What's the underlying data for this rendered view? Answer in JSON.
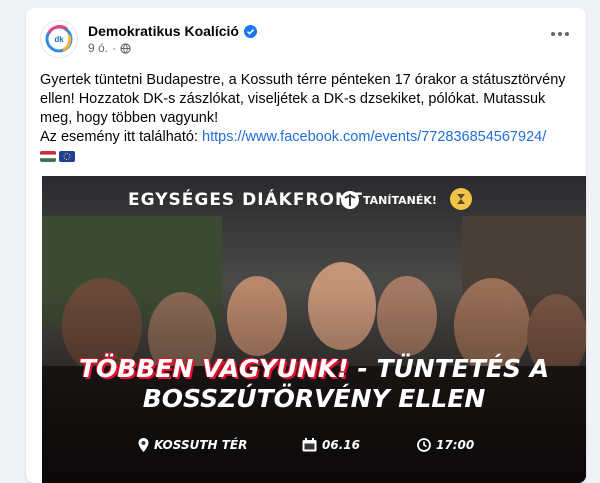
{
  "post": {
    "page_name": "Demokratikus Koalíció",
    "timestamp": "9 ó.",
    "separator": "·",
    "audience_icon": "globe-icon",
    "verified_icon": "verified-badge-icon",
    "more_icon": "more-options-icon",
    "text_line": "Gyertek tüntetni Budapestre, a Kossuth térre pénteken 17 órakor a státusztörvény ellen! Hozzatok DK-s zászlókat, viseljétek a DK-s dzsekiket, pólókat. Mutassuk meg, hogy többen vagyunk!",
    "link_prefix": "Az esemény itt található:",
    "link_url": "https://www.facebook.com/events/772836854567924/",
    "flags": [
      "hungary-flag-icon",
      "eu-flag-icon"
    ],
    "avatar_logo": "dk",
    "colors": {
      "link": "#216fdb",
      "accent_red": "#e0122e"
    }
  },
  "media": {
    "brand_left": "EGYSÉGES DIÁKFRONT",
    "brand_right": "TANÍTANÉK!",
    "headline_red": "TÖBBEN VAGYUNK!",
    "headline_rest": " - TÜNTETÉS A",
    "headline_line2": "BOSSZÚTÖRVÉNY ELLEN",
    "location": "KOSSUTH TÉR",
    "date": "06.16",
    "time": "17:00"
  }
}
